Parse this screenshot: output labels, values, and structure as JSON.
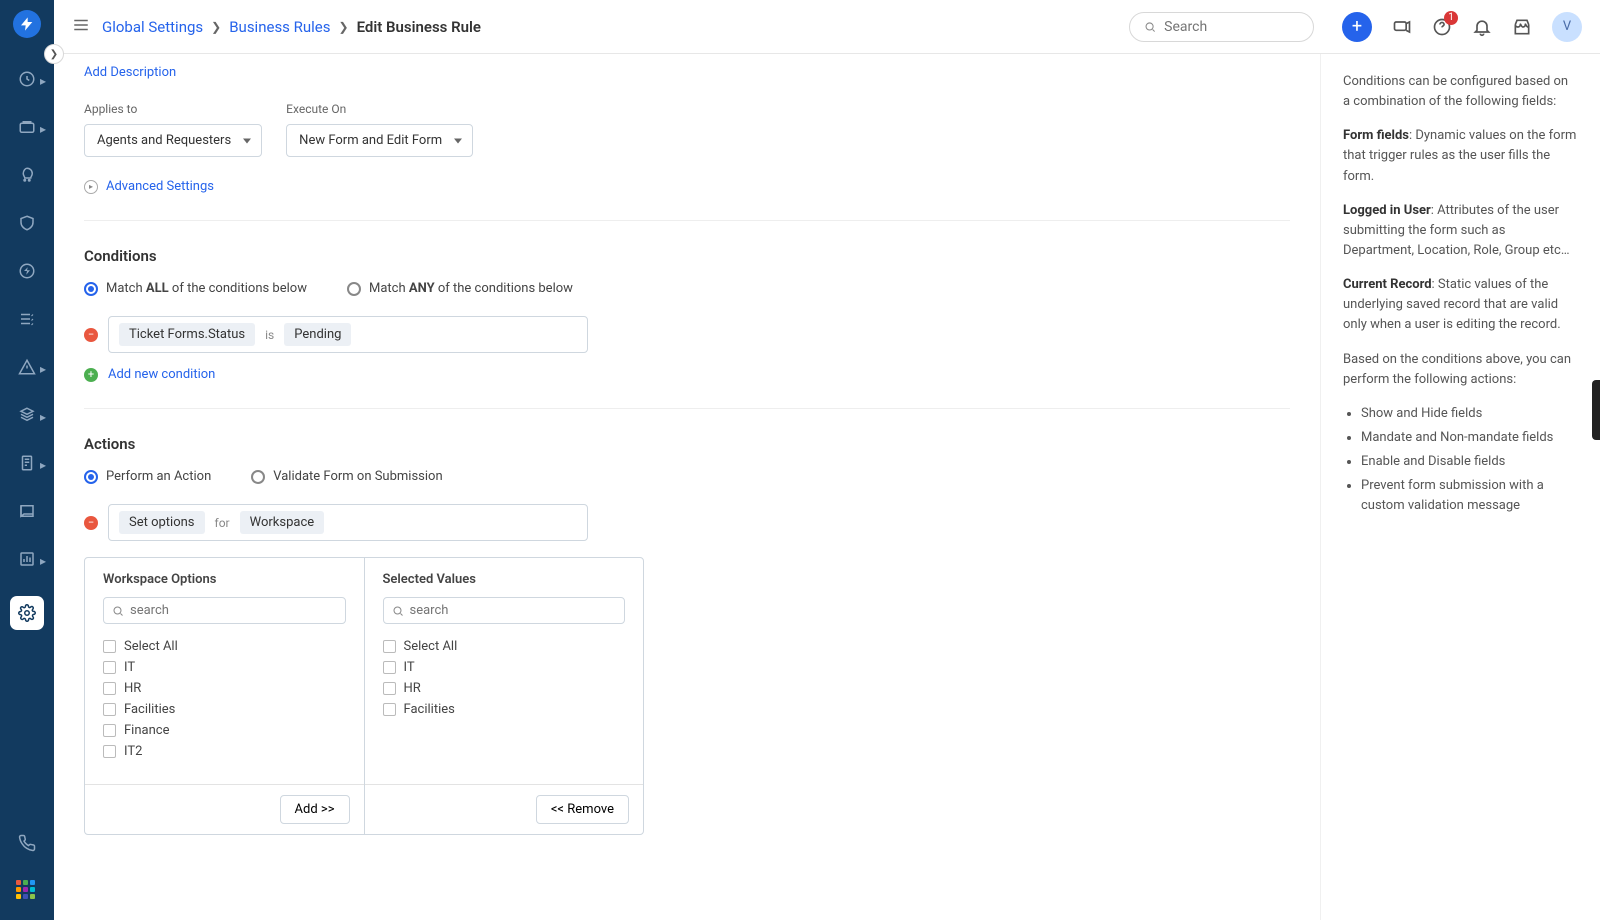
{
  "breadcrumb": {
    "global": "Global Settings",
    "rules": "Business Rules",
    "current": "Edit Business Rule"
  },
  "search": {
    "placeholder": "Search"
  },
  "header": {
    "notif_badge": "1",
    "avatar": "V"
  },
  "form": {
    "add_description": "Add Description",
    "applies_to_label": "Applies to",
    "applies_to_value": "Agents and Requesters",
    "execute_on_label": "Execute On",
    "execute_on_value": "New Form and Edit Form",
    "advanced": "Advanced Settings"
  },
  "conditions": {
    "title": "Conditions",
    "match_all_pre": "Match ",
    "match_all_bold": "ALL",
    "match_all_post": " of the conditions below",
    "match_any_pre": "Match ",
    "match_any_bold": "ANY",
    "match_any_post": " of the conditions below",
    "field": "Ticket Forms.Status",
    "op": "is",
    "value": "Pending",
    "add_new": "Add new condition"
  },
  "actions": {
    "title": "Actions",
    "perform": "Perform an Action",
    "validate": "Validate Form on Submission",
    "set_options": "Set options",
    "for": "for",
    "workspace": "Workspace"
  },
  "picker": {
    "left_title": "Workspace Options",
    "right_title": "Selected Values",
    "search_placeholder": "search",
    "select_all": "Select All",
    "options": [
      "IT",
      "HR",
      "Facilities",
      "Finance",
      "IT2"
    ],
    "selected": [
      "IT",
      "HR",
      "Facilities"
    ],
    "add_btn": "Add >>",
    "remove_btn": "<< Remove"
  },
  "help": {
    "p1": "Conditions can be configured based on a combination of the following fields:",
    "ff_label": "Form fields",
    "ff_text": ": Dynamic values on the form that trigger rules as the user fills the form.",
    "li_label": "Logged in User",
    "li_text": ": Attributes of the user submitting the form such as Department, Location, Role, Group etc…",
    "cr_label": "Current Record",
    "cr_text": ": Static values of the underlying saved record that are valid only when a user is editing the record.",
    "p2": "Based on the conditions above, you can perform the following actions:",
    "bullets": [
      "Show and Hide fields",
      "Mandate and Non-mandate fields",
      "Enable and Disable fields",
      "Prevent form submission with a custom validation message"
    ]
  }
}
